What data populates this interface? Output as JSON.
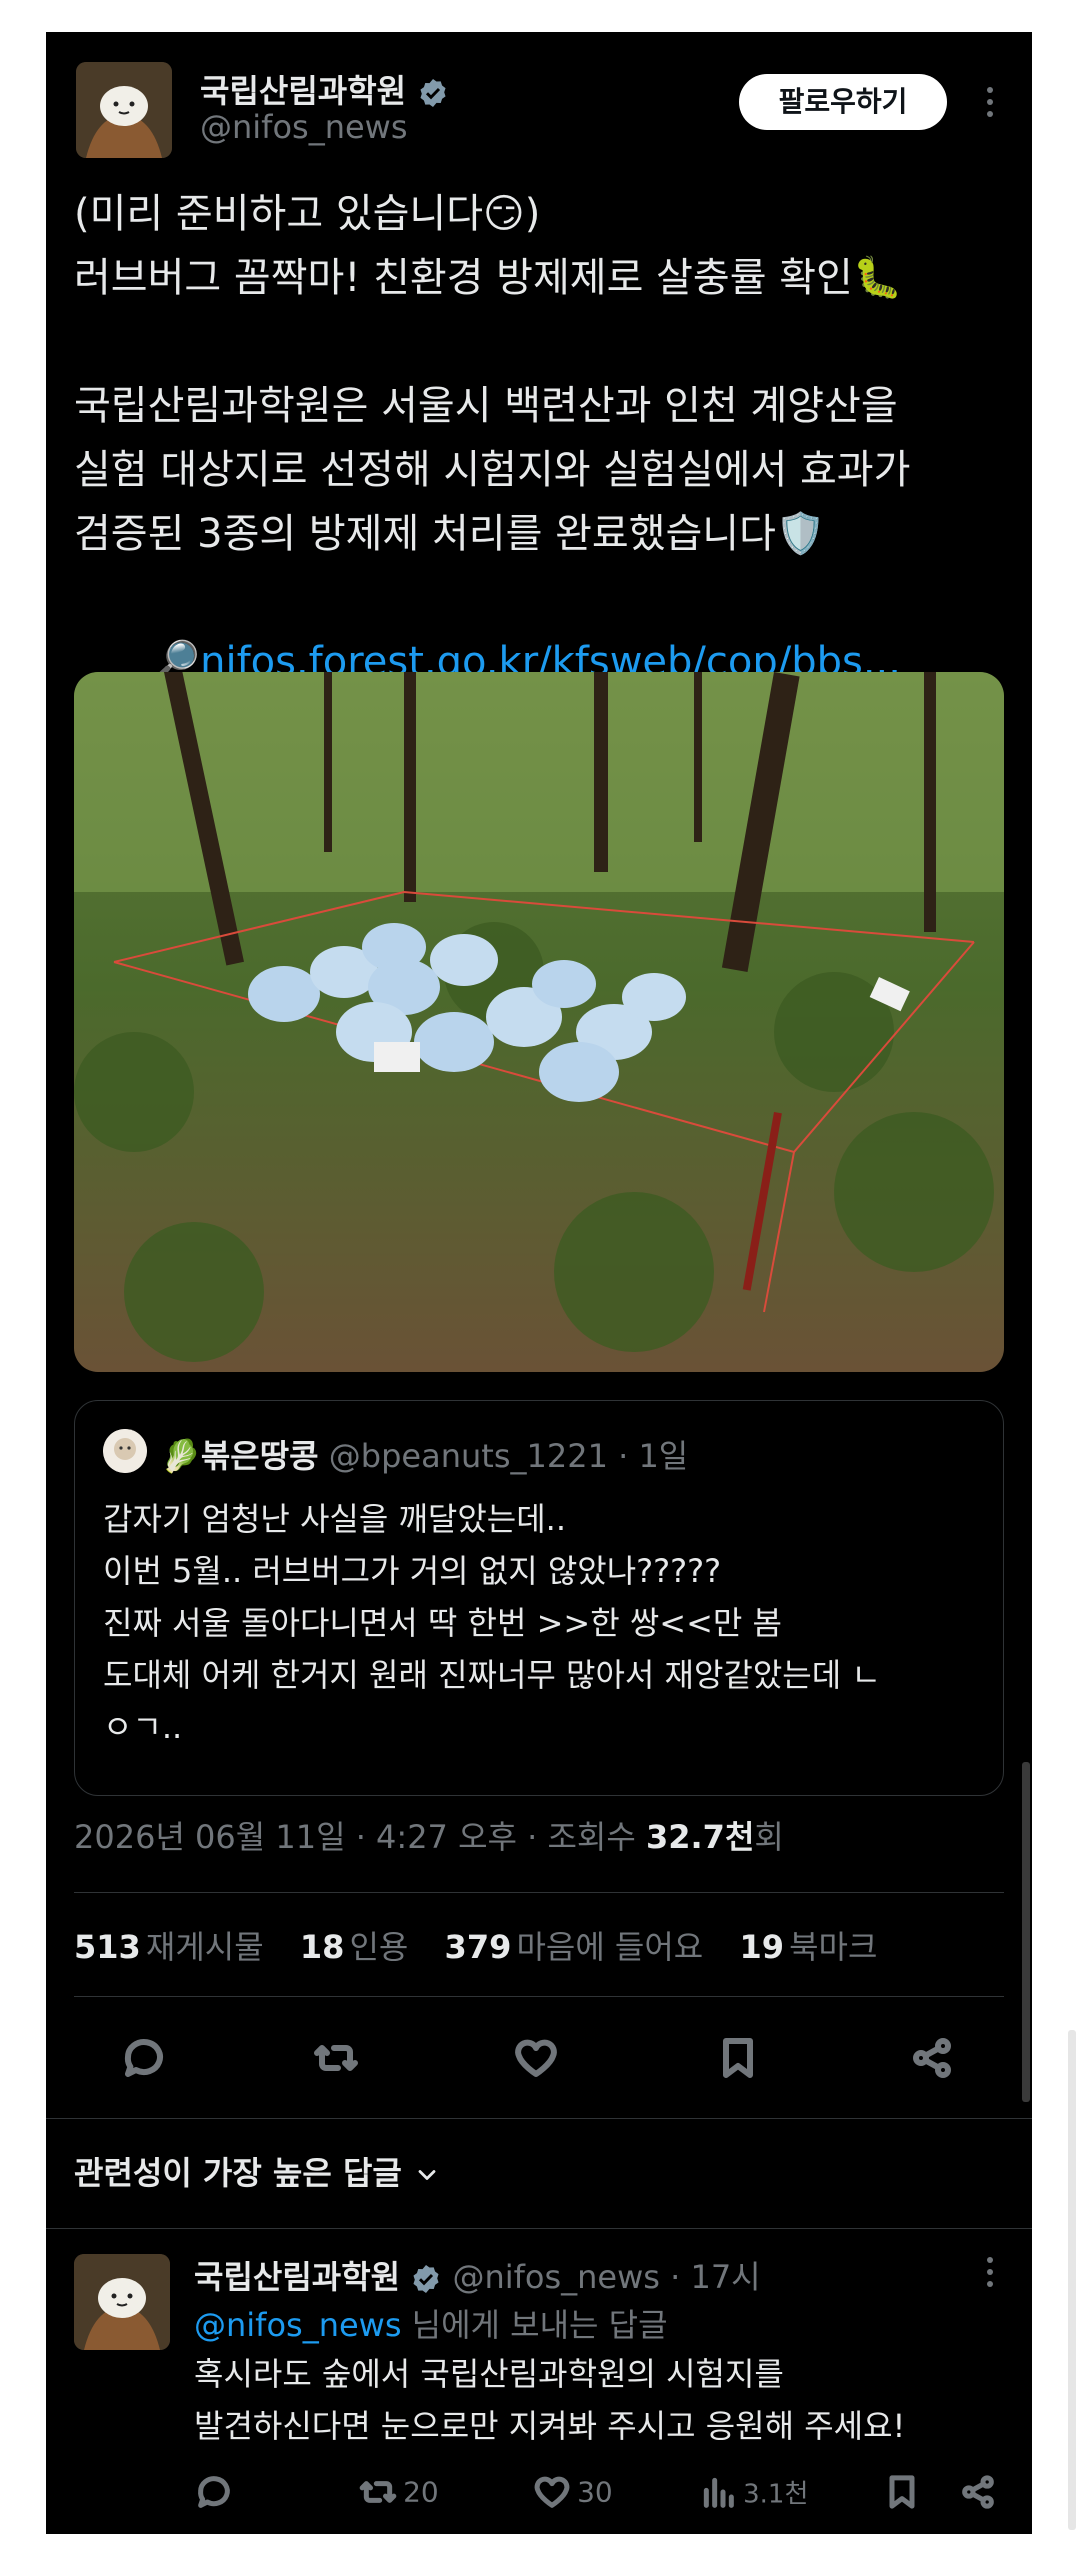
{
  "author": {
    "name": "국립산림과학원",
    "handle": "@nifos_news",
    "follow_label": "팔로우하기"
  },
  "tweet": {
    "lines": [
      "(미리 준비하고 있습니다😏)",
      "러브버그 꼼짝마! 친환경 방제제로 살충률 확인🐛",
      "",
      "국립산림과학원은 서울시 백련산과 인천 계양산을",
      "실험 대상지로 선정해 시험지와 실험실에서 효과가",
      "검증된 3종의 방제제 처리를 완료했습니다🛡️"
    ],
    "link_emoji": "🔎",
    "link_text": "nifos.forest.go.kr/kfsweb/cop/bbs..."
  },
  "quote": {
    "name": "🥬볶은땅콩",
    "handle": "@bpeanuts_1221",
    "time": "· 1일",
    "lines": [
      "갑자기 엄청난 사실을 깨달았는데..",
      "이번 5월.. 러브버그가 거의 없지 않았나?????",
      "진짜 서울 돌아다니면서 딱 한번 >>한 쌍<<만 봄",
      "도대체 어케 한거지 원래 진짜너무 많아서 재앙같았는데 ㄴ",
      "ㅇㄱ.."
    ]
  },
  "meta": {
    "datetime": "2026년 06월 11일 · 4:27 오후 · 조회수 ",
    "views": "32.7천",
    "views_suffix": "회"
  },
  "stats": [
    {
      "num": "513",
      "label": "재게시물"
    },
    {
      "num": "18",
      "label": "인용"
    },
    {
      "num": "379",
      "label": "마음에 들어요"
    },
    {
      "num": "19",
      "label": "북마크"
    }
  ],
  "replies_sort": "관련성이 가장 높은 답글",
  "reply": {
    "name": "국립산림과학원",
    "handle": "@nifos_news",
    "time": "· 17시",
    "mention": "@nifos_news",
    "mention_suffix": " 님에게 보내는 답글",
    "lines": [
      "혹시라도 숲에서 국립산림과학원의 시험지를",
      "발견하신다면 눈으로만 지켜봐 주시고 응원해 주세요!"
    ],
    "retweets": "20",
    "likes": "30",
    "views": "3.1천"
  },
  "colors": {
    "background": "#000000",
    "text": "#e7e9ea",
    "muted": "#71767b",
    "link": "#1d9bf0"
  },
  "icons": [
    "verified-badge-icon",
    "more-icon",
    "reply-icon",
    "retweet-icon",
    "like-icon",
    "bookmark-icon",
    "share-icon",
    "chevron-down-icon",
    "views-icon"
  ]
}
